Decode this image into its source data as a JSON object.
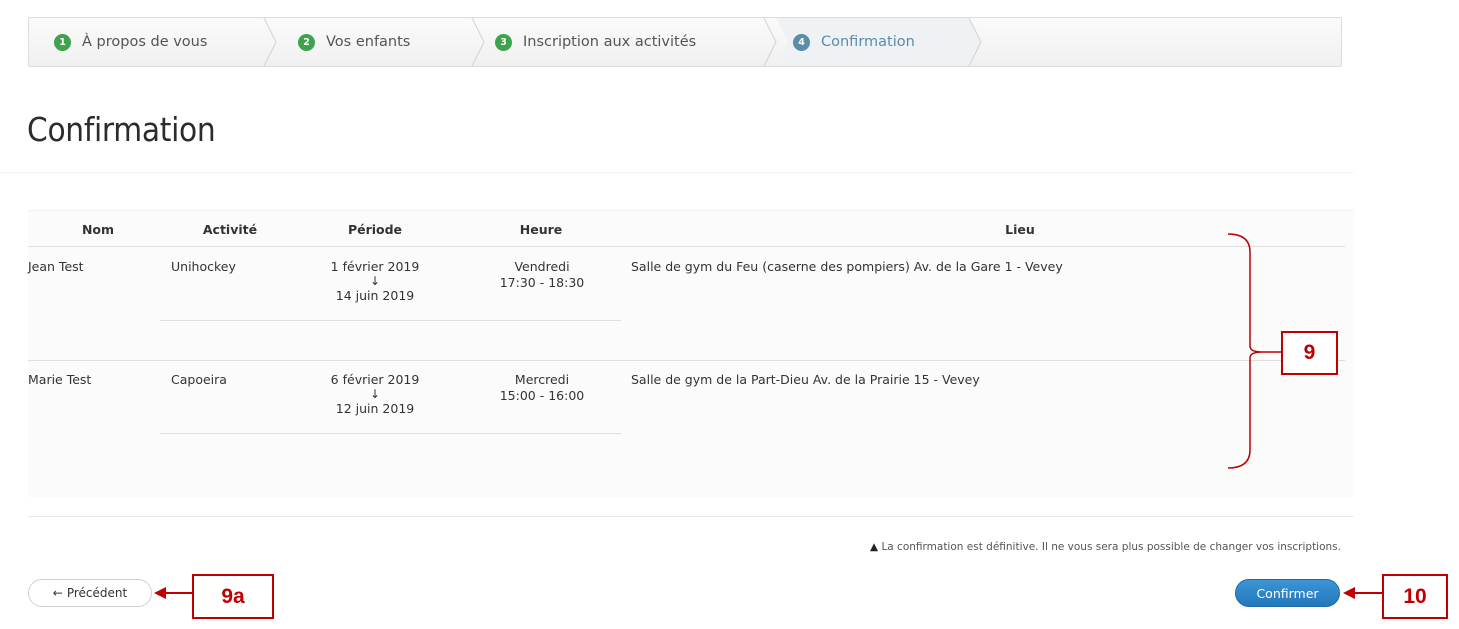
{
  "stepper": {
    "steps": [
      {
        "number": "1",
        "label": "À propos de vous",
        "state": "done"
      },
      {
        "number": "2",
        "label": "Vos enfants",
        "state": "done"
      },
      {
        "number": "3",
        "label": "Inscription aux activités",
        "state": "done"
      },
      {
        "number": "4",
        "label": "Confirmation",
        "state": "current"
      }
    ],
    "colors": {
      "done": "#3fa34d",
      "current": "#5a8da8"
    }
  },
  "page": {
    "title": "Confirmation"
  },
  "table": {
    "headers": {
      "nom": "Nom",
      "activite": "Activité",
      "periode": "Période",
      "heure": "Heure",
      "lieu": "Lieu"
    },
    "rows": [
      {
        "nom": "Jean Test",
        "activite": "Unihockey",
        "periode_start": "1 février 2019",
        "periode_arrow": "↓",
        "periode_end": "14 juin 2019",
        "heure_day": "Vendredi",
        "heure_time": "17:30 - 18:30",
        "lieu": "Salle de gym du Feu (caserne des pompiers) Av. de la Gare 1 - Vevey"
      },
      {
        "nom": "Marie Test",
        "activite": "Capoeira",
        "periode_start": "6 février 2019",
        "periode_arrow": "↓",
        "periode_end": "12 juin 2019",
        "heure_day": "Mercredi",
        "heure_time": "15:00 - 16:00",
        "lieu": "Salle de gym de la Part-Dieu Av. de la Prairie 15 - Vevey"
      }
    ]
  },
  "footer": {
    "notice_icon": "warning-icon",
    "notice_symbol": "▲",
    "notice": "La confirmation est définitive. Il ne vous sera plus possible de changer vos inscriptions.",
    "prev_arrow": "←",
    "prev_label": "Précédent",
    "confirm_label": "Confirmer"
  },
  "annotations": {
    "table_label": "9",
    "prev_label": "9a",
    "confirm_label": "10",
    "color": "#c00000"
  }
}
